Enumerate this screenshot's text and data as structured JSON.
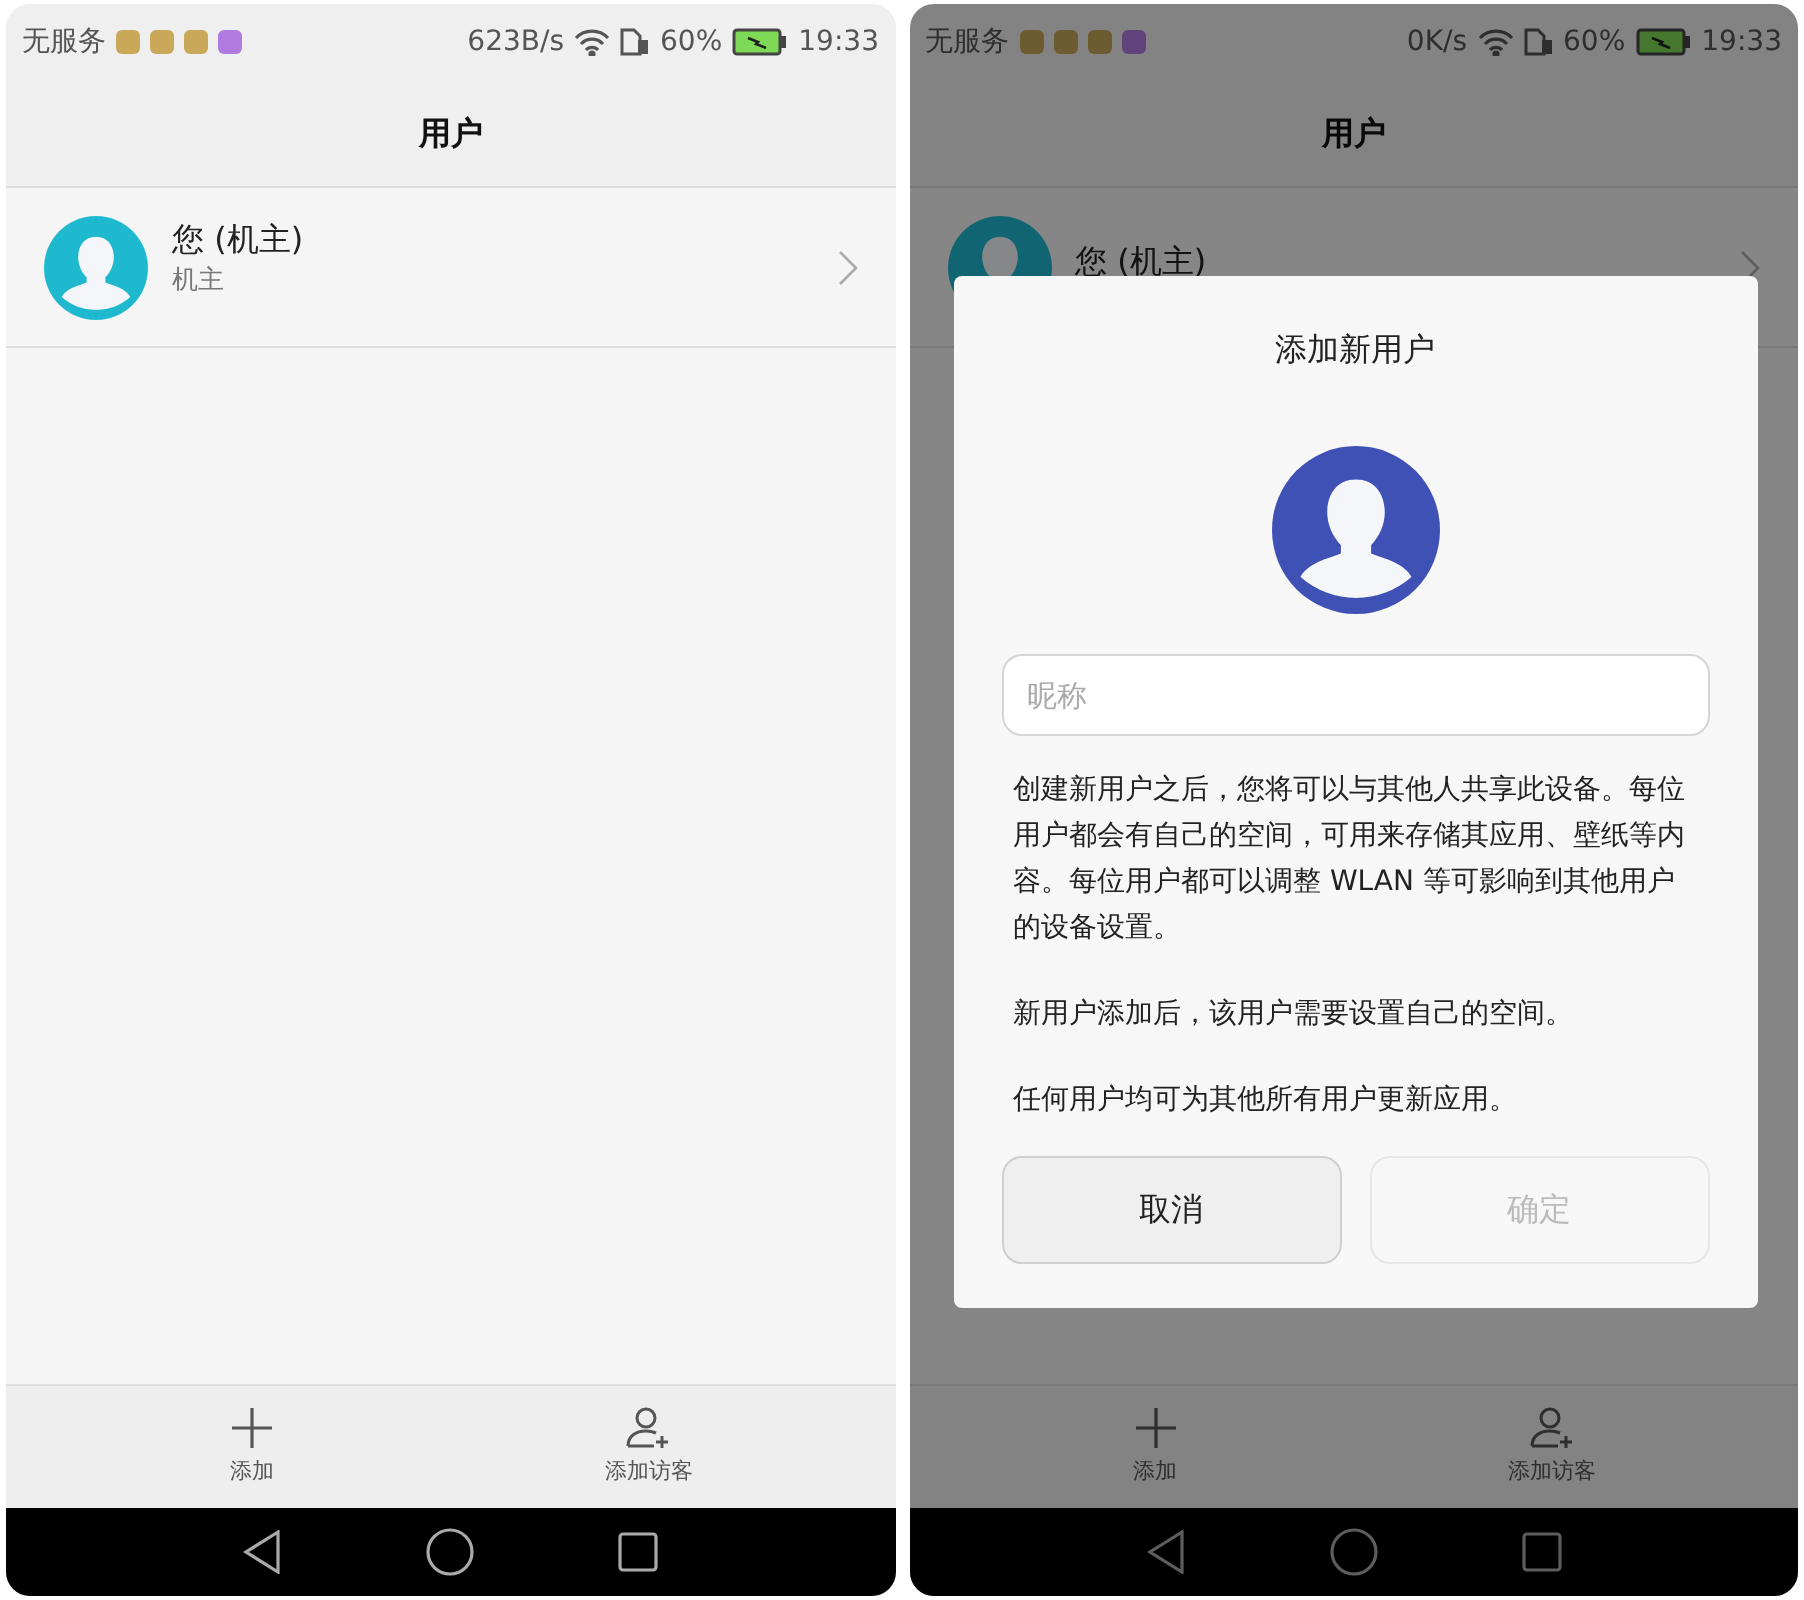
{
  "screens": [
    {
      "status_bar": {
        "carrier": "无服务",
        "speed": "623B/s",
        "battery": "60%",
        "time": "19:33"
      },
      "title": "用户",
      "users": [
        {
          "name": "您 (机主)",
          "role": "机主"
        }
      ],
      "bottom_bar": [
        {
          "kind": "add",
          "label": "添加"
        },
        {
          "kind": "guest",
          "label": "添加访客"
        }
      ]
    },
    {
      "status_bar": {
        "carrier": "无服务",
        "speed": "0K/s",
        "battery": "60%",
        "time": "19:33"
      },
      "title": "用户",
      "users": [
        {
          "name": "您 (机主)"
        }
      ],
      "bottom_bar": [
        {
          "kind": "add",
          "label": "添加"
        },
        {
          "kind": "guest",
          "label": "添加访客"
        }
      ],
      "dialog": {
        "title": "添加新用户",
        "nickname_field": {
          "placeholder": "昵称"
        },
        "paragraphs": [
          "创建新用户之后，您将可以与其他人共享此设备。每位用户都会有自己的空间，可用来存储其应用、壁纸等内容。每位用户都可以调整 WLAN 等可影响到其他用户的设备设置。",
          "新用户添加后，该用户需要设置自己的空间。",
          "任何用户均可为其他所有用户更新应用。"
        ],
        "buttons": [
          {
            "label": "取消",
            "disabled": false
          },
          {
            "label": "确定",
            "disabled": true
          }
        ]
      }
    }
  ]
}
